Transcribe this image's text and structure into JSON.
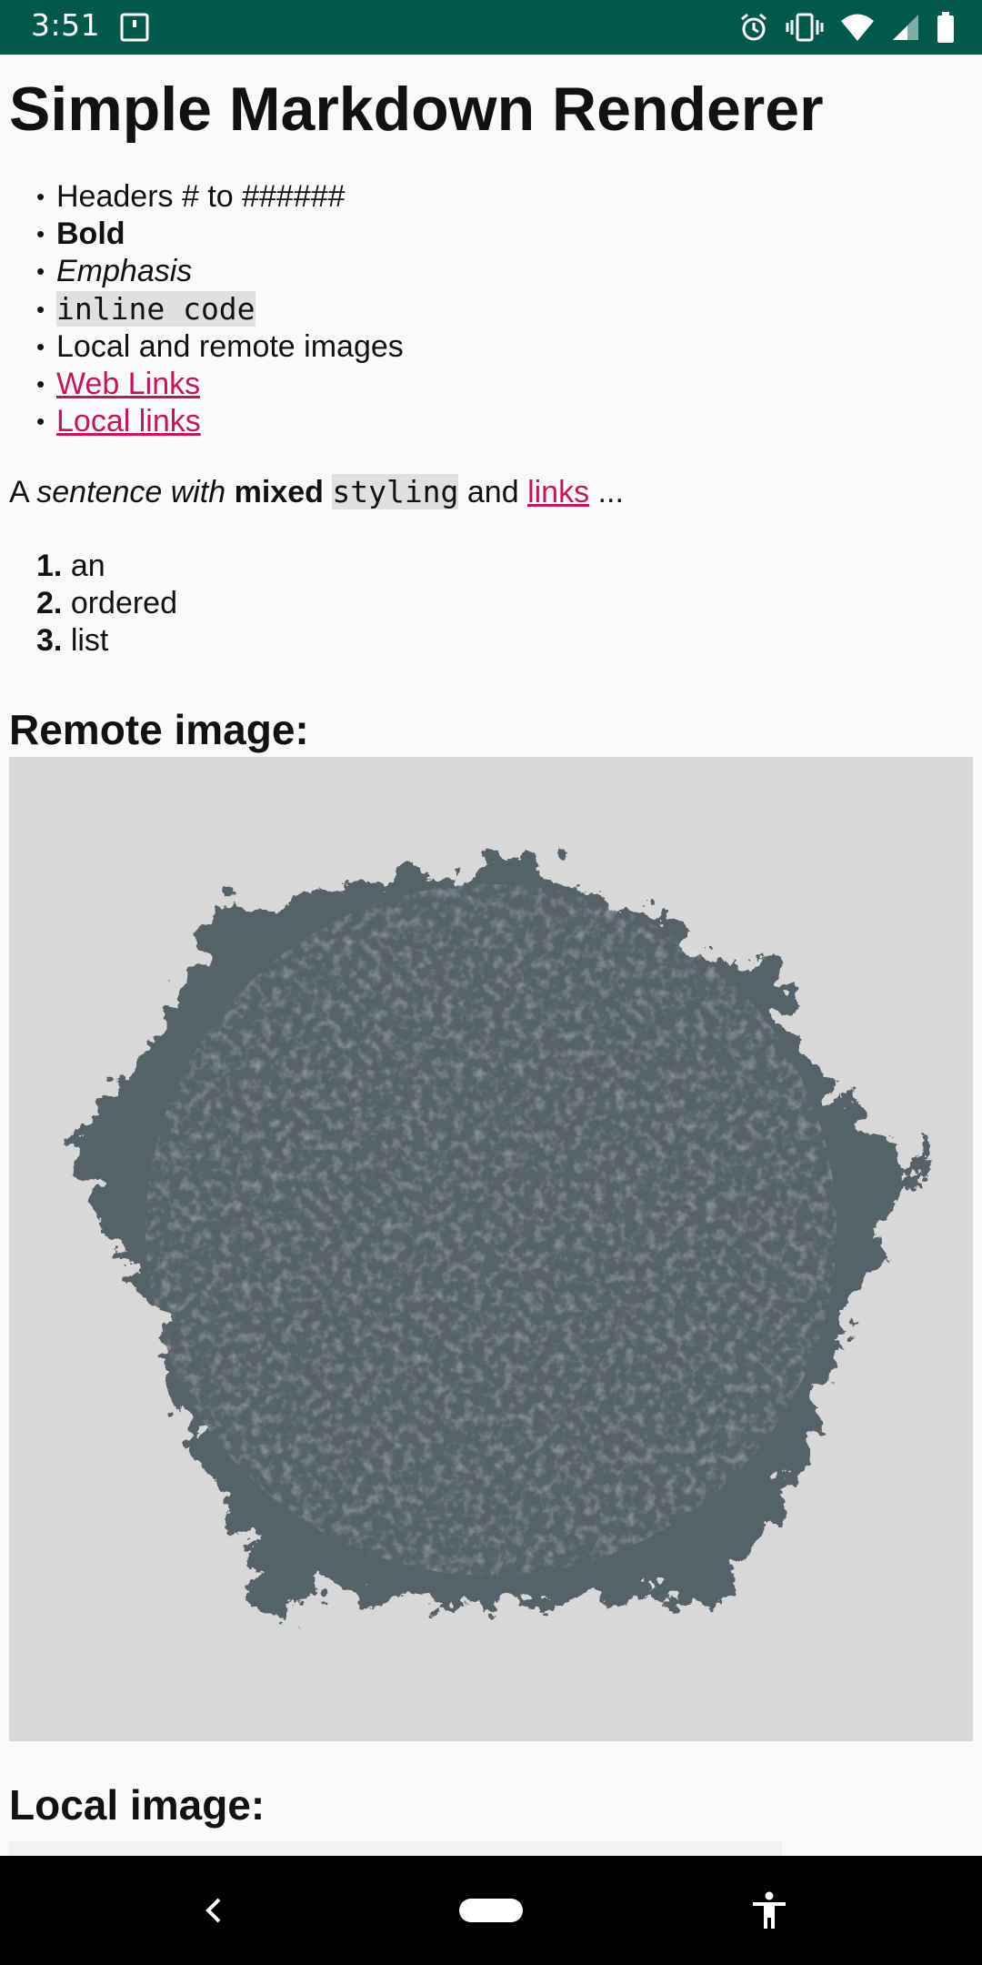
{
  "status_bar": {
    "time": "3:51",
    "left_icon": "sd-card-icon",
    "right_icons": [
      "alarm-icon",
      "vibrate-icon",
      "wifi-icon",
      "signal-icon",
      "battery-icon"
    ],
    "background": "#00594c"
  },
  "page": {
    "title": "Simple Markdown Renderer",
    "bullets": [
      {
        "text": "Headers # to ######",
        "style": "plain"
      },
      {
        "text": "Bold",
        "style": "bold"
      },
      {
        "text": "Emphasis",
        "style": "italic"
      },
      {
        "text": "inline code",
        "style": "code"
      },
      {
        "text": "Local and remote images",
        "style": "plain"
      },
      {
        "text": "Web Links",
        "style": "link"
      },
      {
        "text": "Local links",
        "style": "link"
      }
    ],
    "bullet_glyph": "•",
    "sentence": {
      "a": "A",
      "italic": "sentence with",
      "bold": "mixed",
      "code": "styling",
      "and": "and",
      "link": "links",
      "ellipsis": "..."
    },
    "ordered_list": [
      {
        "num": "1.",
        "text": "an"
      },
      {
        "num": "2.",
        "text": "ordered"
      },
      {
        "num": "3.",
        "text": "list"
      }
    ],
    "remote_heading": "Remote image:",
    "local_heading": "Local image:",
    "link_color": "#c2185b",
    "code_background": "#e0e0e0",
    "image_background": "#d8d8d8",
    "fractal_color": "#57626b"
  },
  "nav_bar": {
    "back_icon": "back-chevron-icon",
    "home_icon": "home-pill-icon",
    "accessibility_icon": "accessibility-icon"
  }
}
